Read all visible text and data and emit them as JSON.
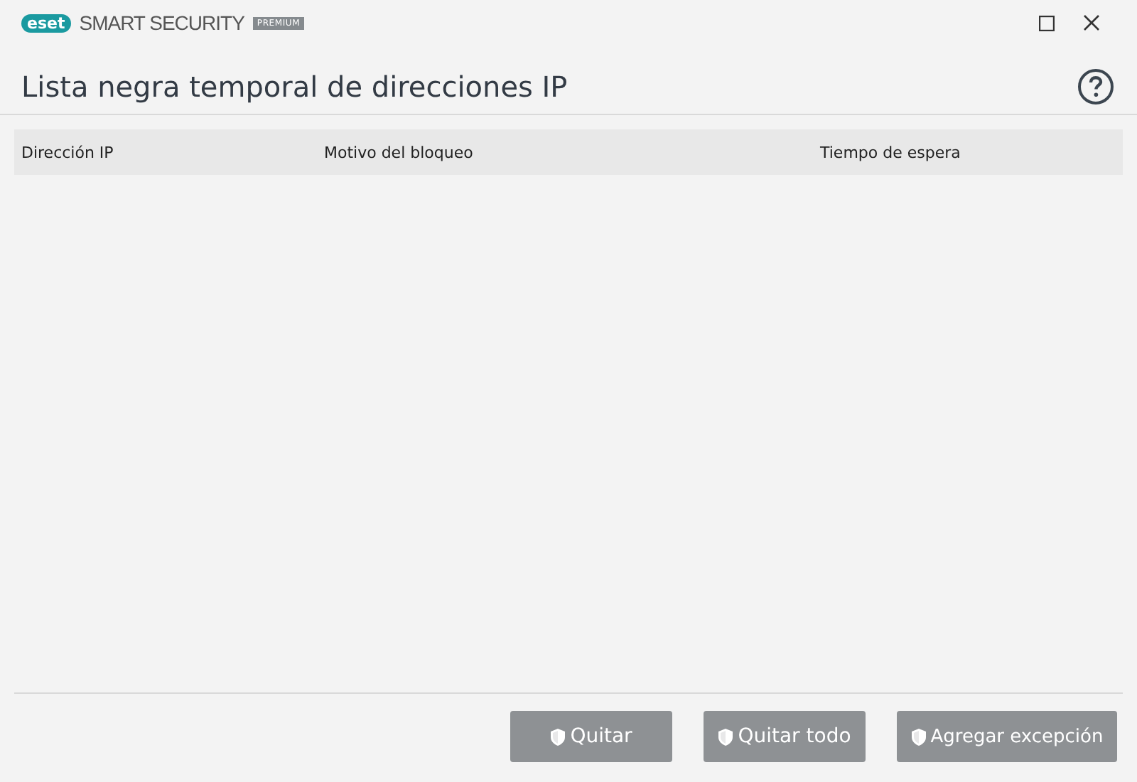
{
  "window": {
    "logo": "eset",
    "product": "SMART SECURITY",
    "edition": "PREMIUM"
  },
  "heading": "Lista negra temporal de direcciones IP",
  "table": {
    "columns": [
      {
        "label": "Dirección IP",
        "kind": "ip"
      },
      {
        "label": "Motivo del bloqueo",
        "kind": "reason"
      },
      {
        "label": "Tiempo de espera",
        "kind": "timeout"
      }
    ]
  },
  "buttons": [
    {
      "label": "Quitar",
      "disabled": true,
      "kind": "remove"
    },
    {
      "label": "Quitar todo",
      "disabled": true,
      "kind": "remove-all"
    },
    {
      "label": "Agregar excepción",
      "disabled": true,
      "kind": "exception"
    }
  ]
}
